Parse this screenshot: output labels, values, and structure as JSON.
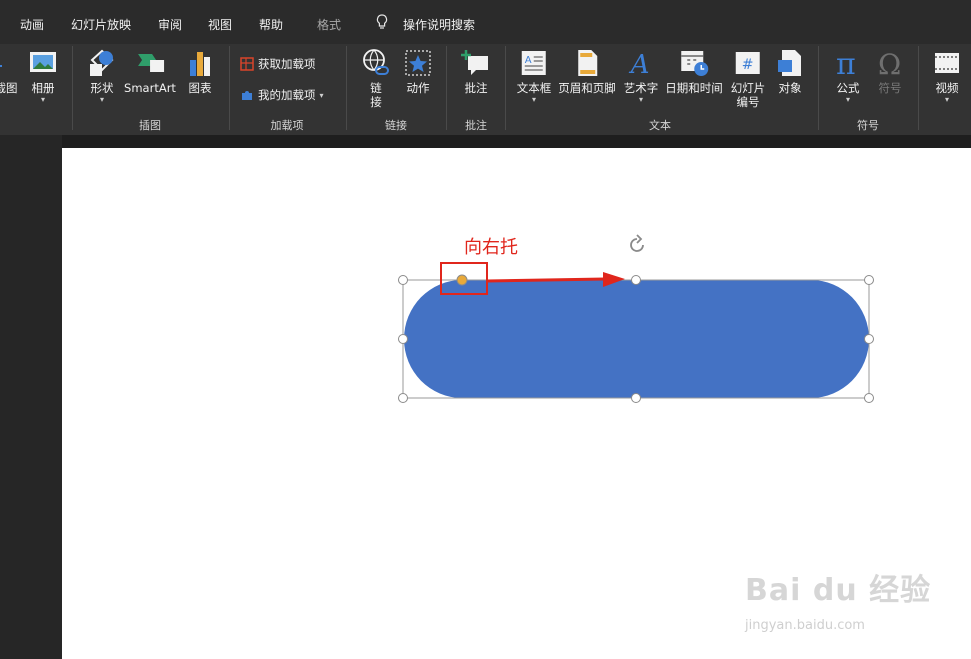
{
  "tabs": [
    "动画",
    "幻灯片放映",
    "审阅",
    "视图",
    "帮助",
    "格式"
  ],
  "tell_me": "操作说明搜索",
  "ribbon": {
    "images": {
      "screenshot_label": "截图",
      "album_label": "相册"
    },
    "illustrations": {
      "shapes": "形状",
      "smartart": "SmartArt",
      "chart": "图表",
      "group": "插图"
    },
    "addins": {
      "get": "获取加载项",
      "my": "我的加载项",
      "group": "加载项"
    },
    "links": {
      "link_line1": "链",
      "link_line2": "接",
      "action": "动作",
      "group": "链接"
    },
    "comments": {
      "comment": "批注",
      "group": "批注"
    },
    "text": {
      "textbox": "文本框",
      "header_footer": "页眉和页脚",
      "wordart": "艺术字",
      "datetime": "日期和时间",
      "slide_num_line1": "幻灯片",
      "slide_num_line2": "编号",
      "object": "对象",
      "group": "文本"
    },
    "symbols": {
      "equation": "公式",
      "symbol": "符号",
      "group": "符号"
    },
    "media": {
      "video": "视频"
    }
  },
  "slide": {
    "annotation": "向右托",
    "shape_fill": "#4472c4",
    "annotation_color": "#e0261c",
    "handle_color": "#e8a93a"
  },
  "watermark": {
    "brand": "Bai du 经验",
    "url": "jingyan.baidu.com"
  }
}
